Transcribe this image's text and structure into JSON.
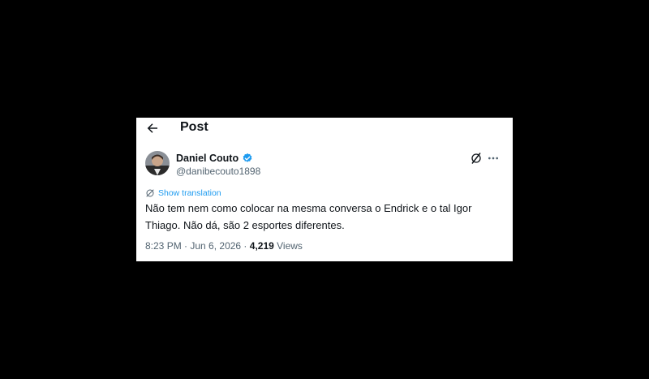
{
  "header": {
    "title": "Post"
  },
  "author": {
    "name": "Daniel Couto",
    "handle": "@danibecouto1898",
    "verified": true
  },
  "translate": {
    "label": "Show translation"
  },
  "tweet": {
    "text": "Não tem nem como colocar na mesma conversa o Endrick e o tal Igor\nThiago. Não dá, são 2 esportes diferentes."
  },
  "meta": {
    "time": "8:23 PM",
    "separator1": " · ",
    "date": "Jun 6, 2026",
    "separator2": " · ",
    "views_count": "4,219",
    "views_label": " Views"
  },
  "colors": {
    "accent": "#1d9bf0",
    "text": "#0f1419",
    "muted": "#536471",
    "background": "#000000"
  },
  "icons": [
    "back-arrow-icon",
    "verified-badge-icon",
    "grok-icon",
    "more-options-icon",
    "globe-icon"
  ]
}
